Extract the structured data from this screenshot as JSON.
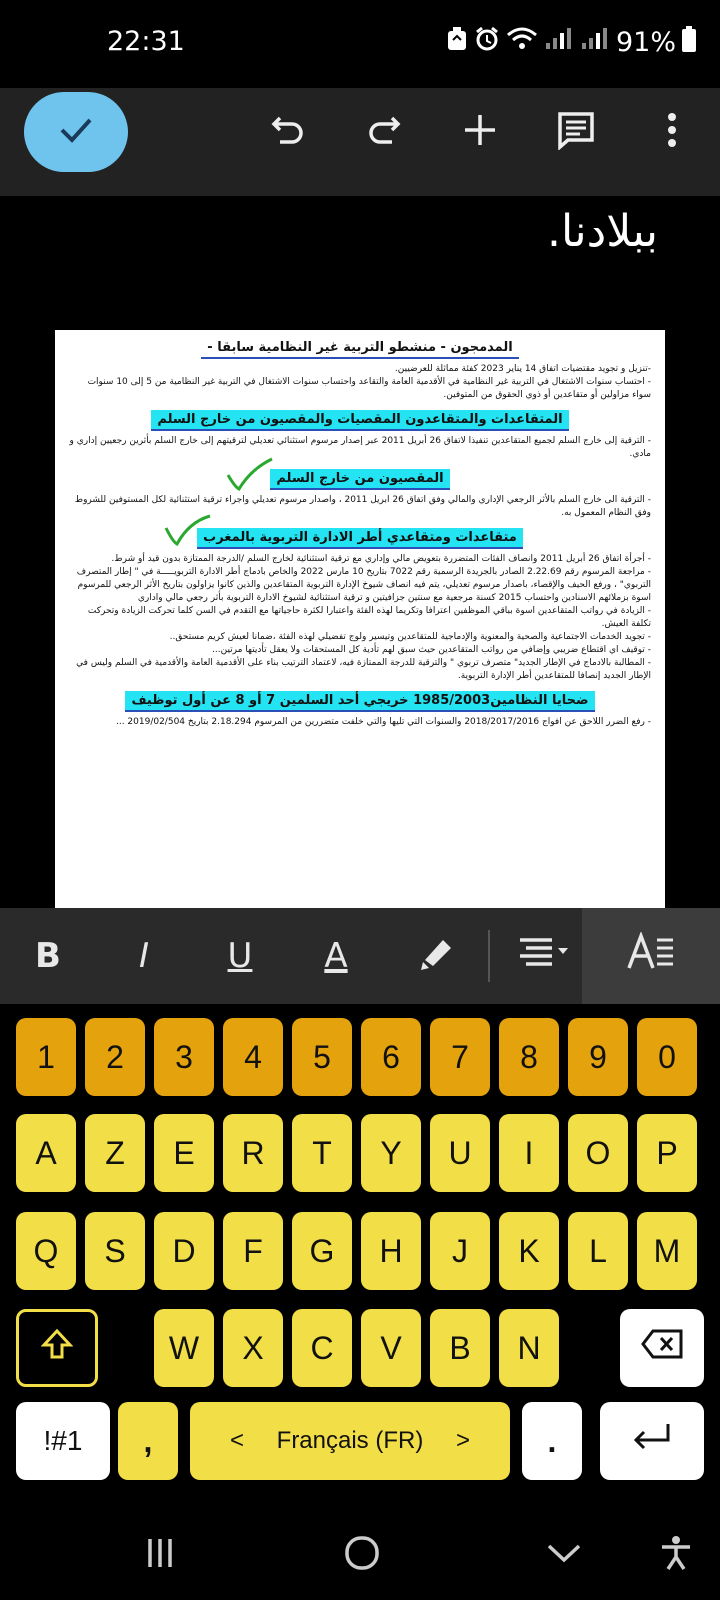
{
  "status": {
    "time": "22:31",
    "battery": "91%"
  },
  "document": {
    "visible_text": "ببلادنا.",
    "page": {
      "sections": [
        {
          "title": "المدمجون - منشطو التربية غير النظامية سابقا -",
          "lines": [
            "-تنزيل و تجويد مقتضيات اتفاق 14 يناير 2023 كفئة مماثلة للعرضيين.",
            "- احتساب سنوات الاشتغال في التربية غير النظامية في الأقدمية العامة والتقاعد واحتساب سنوات الاشتغال في التربية غير النظامية من 5 إلى 10 سنوات سواء مزاولين أو متقاعدين أو ذوي الحقوق من المتوفين."
          ]
        },
        {
          "title": "المتقاعدات والمتقاعدون المقصيات والمقصيون من خارج السلم",
          "lines": [
            "- الترقية إلى خارج السلم لجميع المتقاعدين تنفيذا لاتفاق 26 أبريل 2011 عبر إصدار مرسوم استثنائي تعديلي لترقيتهم إلى خارج السلم بأثرين رجعيين إداري و مادي."
          ]
        },
        {
          "title": "المقصيون من خارج السلم",
          "lines": [
            "- الترقية الى خارج السلم بالأثر الرجعي الإداري والمالي وفق اتفاق 26 ابريل 2011 ، واصدار مرسوم تعديلي واجراء ترقية استثنائية لكل المستوفين للشروط وفق النظام المعمول به."
          ]
        },
        {
          "title": "متقاعدات ومتقاعدي أطر الادارة التربوية بالمغرب",
          "lines": [
            "- أجرأة اتفاق 26 أبريل 2011 وانصاف الفئات المتضررة بتعويض مالي وإداري مع ترقية استثنائية لخارج السلم /الدرجة الممتازة بدون قيد أو شرط.",
            "- مراجعة المرسوم رقم 2.22.69 الصادر بالجريدة الرسمية رقم 7022 بتاريخ 10 مارس 2022 والخاص بادماج أطر الادارة التربويـــــة في \" إطار المتصرف التربوي\" ، ورفع الحيف والإقصاء، باصدار مرسوم تعديلي، يتم فيه انصاف شيوخ الإدارة التربوية المتقاعدين والذين كانوا يزاولون بتاريخ الأثر الرجعي للمرسوم اسوة بزملائهم الاسنادين واحتساب 2015 كسنة مرجعية مع سنتين جزافيتين و ترقية استثنائية لشيوخ الادارة التربوية بأثر رجعي مالي واداري",
            "- الزيادة في رواتب المتقاعدين اسوة بباقي الموظفين اعترافا وتكريما لهذه الفئة واعتبارا لكثرة حاجياتها مع التقدم في السن كلما تحركت الزيادة وتحركت تكلفة العيش.",
            "- تجويد الخدمات الاجتماعية والصحية والمعنوية والإدماجية للمتقاعدين وتيسير ولوج تفضيلي لهذه الفئة ،ضمانا لعيش كريم مستحق..",
            "- توقيف اي اقتطاع ضريبي وإضافي من رواتب المتقاعدين حيث سبق لهم تأدية كل المستحقات ولا يعقل تأديتها مرتين...",
            "- المطالبة بالادماج في الإطار الجديد\" متصرف تربوي \" والترقية للدرجة الممتازة فيه، لاعتماد الترتيب بناء على الأقدمية العامة والأقدمية في السلم وليس في الإطار الجديد إنصافا للمتقاعدين أطر الإدارة التربوية."
          ]
        },
        {
          "title": "ضحايا النظامين1985/2003 خريجي أحد السلمين 7 أو 8 عن أول توظيف",
          "lines": [
            "- رفع الضرر اللاحق عن افواج 2018/2017/2016 والسنوات التي تليها والتي خلفت متضررين من المرسوم 2.18.294 بتاريخ 2019/02/504 ..."
          ]
        }
      ]
    }
  },
  "formatting": {
    "bold": "B",
    "italic": "I",
    "underline": "U",
    "text_color": "A"
  },
  "keyboard": {
    "numbers": [
      "1",
      "2",
      "3",
      "4",
      "5",
      "6",
      "7",
      "8",
      "9",
      "0"
    ],
    "row1": [
      "A",
      "Z",
      "E",
      "R",
      "T",
      "Y",
      "U",
      "I",
      "O",
      "P"
    ],
    "row2": [
      "Q",
      "S",
      "D",
      "F",
      "G",
      "H",
      "J",
      "K",
      "L",
      "M"
    ],
    "row3": [
      "W",
      "X",
      "C",
      "V",
      "B",
      "N"
    ],
    "symbols_key": "!#1",
    "comma_key": ",",
    "space_label": "Français (FR)",
    "space_left_arrow": "<",
    "space_right_arrow": ">",
    "period_key": ".",
    "colors": {
      "letter_key": "#f2de46",
      "number_key": "#e4a20d"
    }
  },
  "icons": {
    "toolbar": [
      "check-icon",
      "undo-icon",
      "redo-icon",
      "add-icon",
      "comment-icon",
      "more-vert-icon"
    ],
    "formatting": [
      "highlighter-icon",
      "align-icon",
      "text-format-icon"
    ],
    "nav": [
      "recents-icon",
      "home-icon",
      "back-icon",
      "accessibility-icon"
    ]
  },
  "accent_color": "#6fc4ee"
}
